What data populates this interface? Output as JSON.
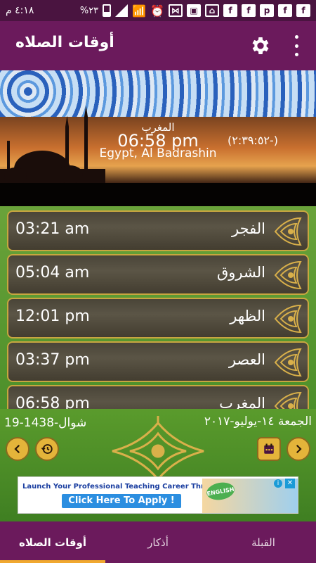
{
  "status_bar": {
    "time": "٤:١٨ م",
    "battery": "%٢٣"
  },
  "app_bar": {
    "title": "أوقات الصلاه"
  },
  "current_prayer": {
    "name": "المغرب",
    "time": "06:58 pm",
    "location": "Egypt, Al Badrashin",
    "countdown": "(-٢:٣٩:٥٢)"
  },
  "pager": {
    "count": 6,
    "active_index": 4
  },
  "prayers": [
    {
      "name": "الفجر",
      "time": "03:21 am"
    },
    {
      "name": "الشروق",
      "time": "05:04 am"
    },
    {
      "name": "الظهر",
      "time": "12:01 pm"
    },
    {
      "name": "العصر",
      "time": "03:37 pm"
    },
    {
      "name": "المغرب",
      "time": "06:58 pm"
    }
  ],
  "dates": {
    "hijri": "19-شوال-1438",
    "gregorian": "الجمعة ١٤-يوليو-٢٠١٧"
  },
  "ad": {
    "headline": "Launch Your Professional Teaching Career Through EPIK",
    "cta": "Click Here To Apply !",
    "badge": "ENGLISH"
  },
  "bottom_nav": {
    "tabs": [
      {
        "label": "أوقات الصلاه",
        "active": true
      },
      {
        "label": "أذكار",
        "active": false
      },
      {
        "label": "القبلة",
        "active": false
      }
    ]
  },
  "colors": {
    "primary": "#6b1a5c",
    "accent": "#f0a830",
    "gold": "#e4b43a"
  }
}
